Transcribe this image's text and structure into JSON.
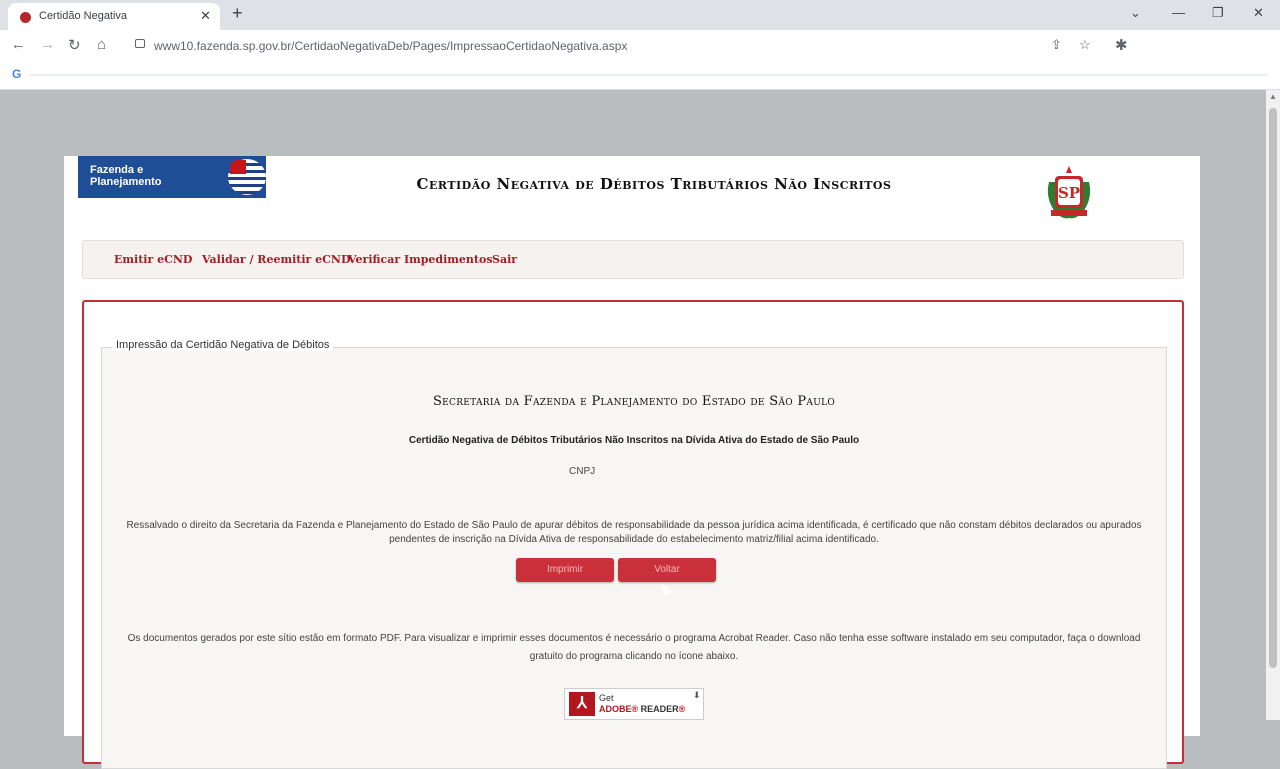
{
  "browser": {
    "tab_title": "Certidão Negativa",
    "url": "www10.fazenda.sp.gov.br/CertidaoNegativaDeb/Pages/ImpressaoCertidaoNegativa.aspx"
  },
  "header": {
    "logo_text": "Fazenda e Planejamento",
    "title": "Certidão Negativa de Débitos Tributários Não Inscritos",
    "emblem_text": "SP"
  },
  "menu": {
    "items": [
      "Emitir eCND",
      "Validar / Reemitir eCND",
      "Verificar Impedimentos",
      "Sair"
    ]
  },
  "panel": {
    "legend": "Impressão da Certidão Negativa de Débitos",
    "secretaria": "Secretaria da Fazenda e Planejamento do Estado de São Paulo",
    "certidao_subtitle": "Certidão Negativa de Débitos Tributários Não Inscritos na Dívida Ativa do Estado de São Paulo",
    "cnpj_label": "CNPJ",
    "cnpj_value": "",
    "body_text": "Ressalvado o direito da Secretaria da Fazenda e Planejamento do Estado de São Paulo de apurar débitos de responsabilidade da pessoa jurídica acima identificada, é certificado que não constam débitos declarados ou apurados pendentes de inscrição na Dívida Ativa de responsabilidade do estabelecimento matriz/filial acima identificado.",
    "print_button": "Imprimir",
    "back_button": "Voltar",
    "pdf_notice": "Os documentos gerados por este sítio estão em formato PDF. Para visualizar e imprimir esses documentos é necessário o programa Acrobat Reader. Caso não tenha esse software instalado em seu computador, faça o download gratuito do programa clicando no ícone abaixo.",
    "reader_get": "Get",
    "reader_brand": "ADOBE",
    "reader_name": "READER"
  }
}
